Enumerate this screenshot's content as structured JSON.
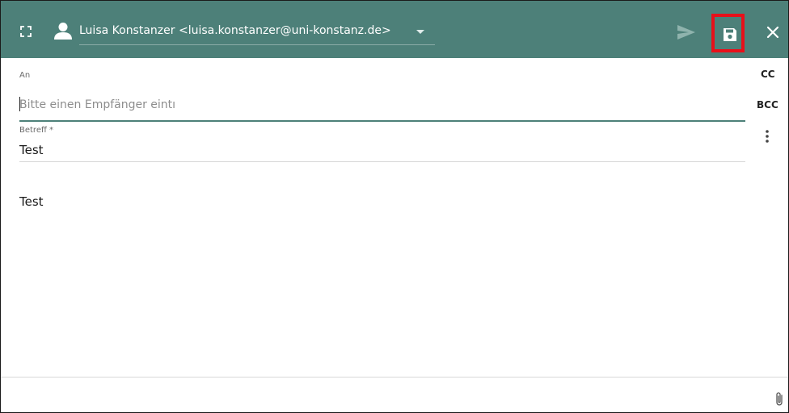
{
  "header": {
    "from_account": "Luisa Konstanzer <luisa.konstanzer@uni-konstanz.de>",
    "icons": {
      "expand": "expand-icon",
      "sender": "person-icon",
      "dropdown": "chevron-down-icon",
      "send": "send-icon",
      "save": "save-icon",
      "close": "close-icon"
    },
    "colors": {
      "bar": "#4d8079",
      "highlight": "#e8101a"
    }
  },
  "recipients": {
    "to_label": "An",
    "to_placeholder": "Bitte einen Empfänger eintı",
    "cc_label": "CC",
    "bcc_label": "BCC"
  },
  "subject": {
    "label": "Betreff *",
    "value": "Test"
  },
  "body": {
    "text": "Test"
  },
  "footer": {
    "icons": {
      "attach": "paperclip-icon"
    }
  }
}
